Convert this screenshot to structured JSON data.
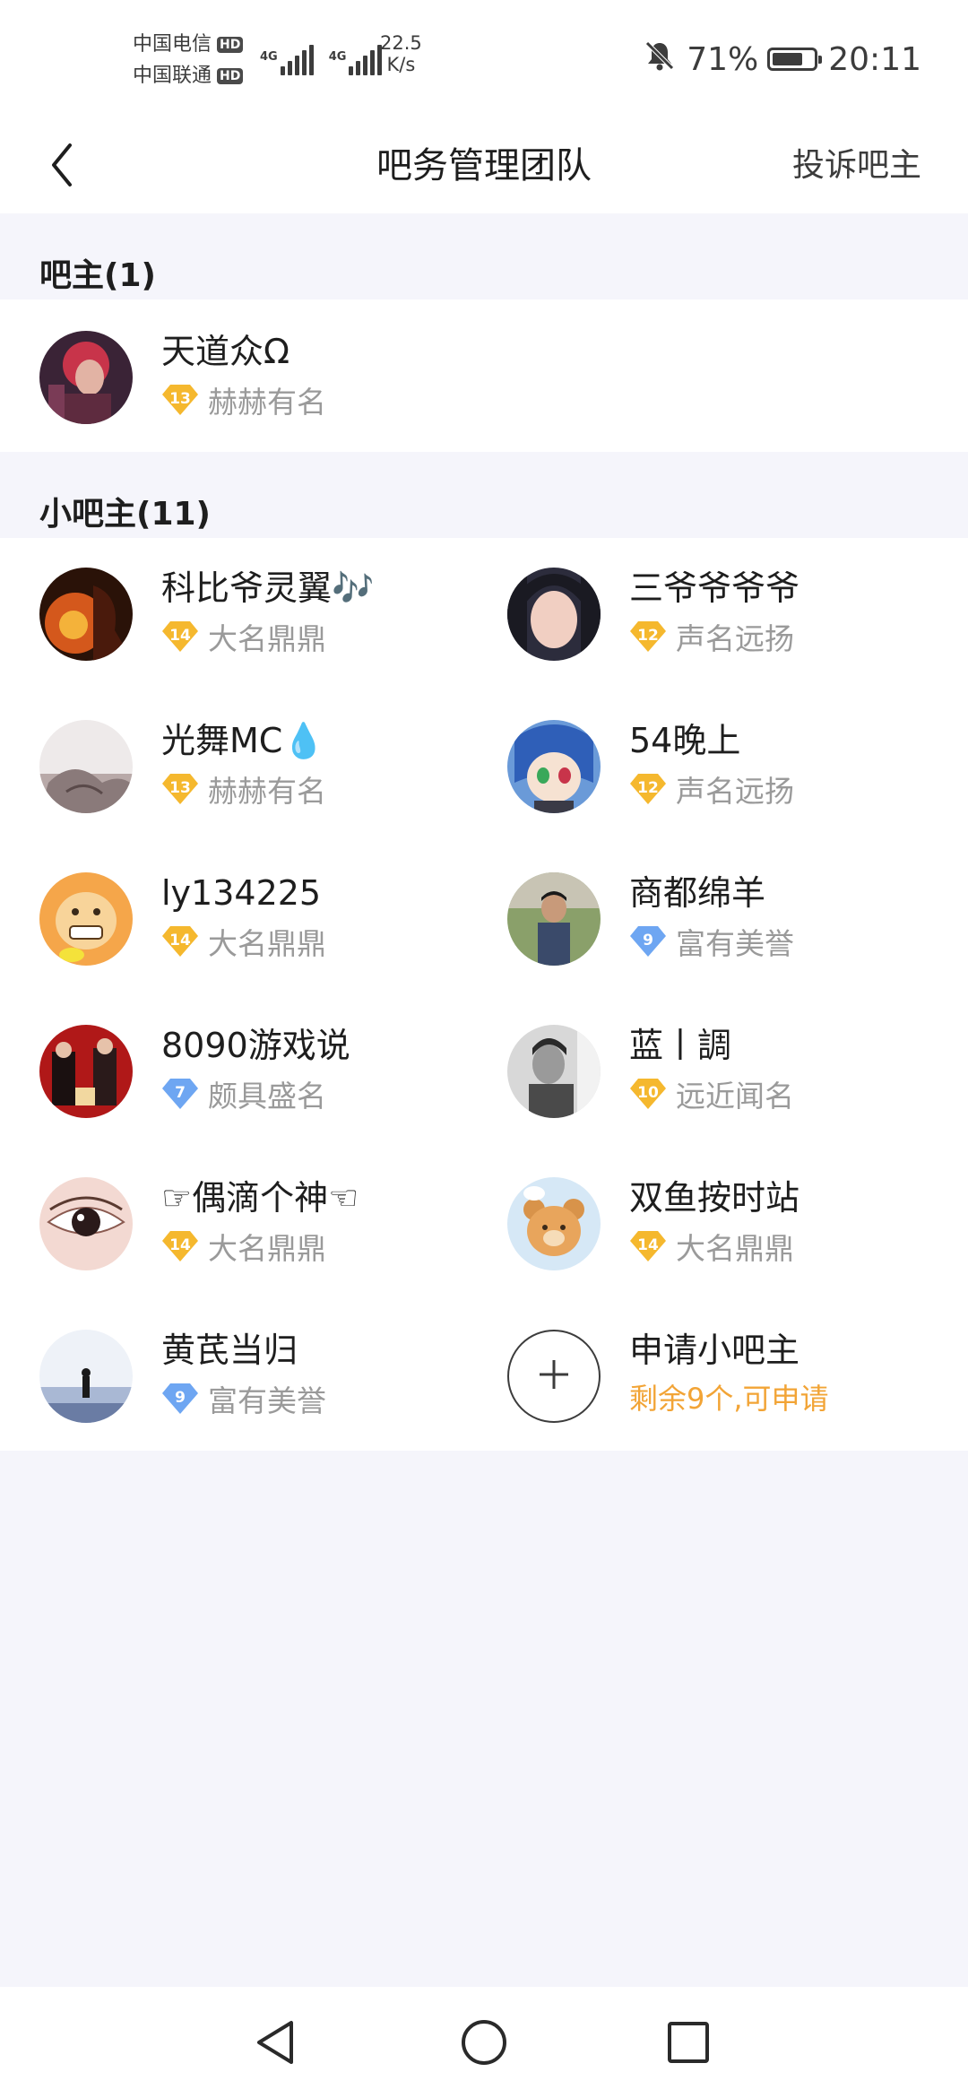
{
  "status_bar": {
    "carriers": [
      "中国电信",
      "中国联通"
    ],
    "hd_label": "HD",
    "network_type": "4G",
    "speed_value": "22.5",
    "speed_unit": "K/s",
    "battery": "71%",
    "time": "20:11"
  },
  "header": {
    "title": "吧务管理团队",
    "complaint": "投诉吧主"
  },
  "owner_section": {
    "title": "吧主(1)",
    "members": [
      {
        "name": "天道众Ω",
        "level": "13",
        "level_title": "赫赫有名",
        "badge_color": "#f5b82e"
      }
    ]
  },
  "moderator_section": {
    "title": "小吧主(11)",
    "members": [
      {
        "name": "科比爷灵翼🎶",
        "level": "14",
        "level_title": "大名鼎鼎",
        "badge_color": "#f5b82e"
      },
      {
        "name": "三爷爷爷爷",
        "level": "12",
        "level_title": "声名远扬",
        "badge_color": "#f5b82e"
      },
      {
        "name": "光舞MC💧",
        "level": "13",
        "level_title": "赫赫有名",
        "badge_color": "#f5b82e"
      },
      {
        "name": "54晚上",
        "level": "12",
        "level_title": "声名远扬",
        "badge_color": "#f5b82e"
      },
      {
        "name": "ly134225",
        "level": "14",
        "level_title": "大名鼎鼎",
        "badge_color": "#f5b82e"
      },
      {
        "name": "商都绵羊",
        "level": "9",
        "level_title": "富有美誉",
        "badge_color": "#6ea6f2"
      },
      {
        "name": "8090游戏说",
        "level": "7",
        "level_title": "颇具盛名",
        "badge_color": "#6ea6f2"
      },
      {
        "name": "蓝丨調",
        "level": "10",
        "level_title": "远近闻名",
        "badge_color": "#f5b82e"
      },
      {
        "name": "☞偶滴个神☜",
        "level": "14",
        "level_title": "大名鼎鼎",
        "badge_color": "#f5b82e"
      },
      {
        "name": "双鱼按时站",
        "level": "14",
        "level_title": "大名鼎鼎",
        "badge_color": "#f5b82e"
      },
      {
        "name": "黄芪当归",
        "level": "9",
        "level_title": "富有美誉",
        "badge_color": "#6ea6f2"
      }
    ],
    "apply": {
      "label": "申请小吧主",
      "sub": "剩余9个,可申请"
    }
  },
  "colors": {
    "accent_orange": "#f2a436",
    "badge_gold": "#f5b82e",
    "badge_blue": "#6ea6f2",
    "page_background": "#f5f5fb"
  },
  "icons": {
    "back": "chevron-left-icon",
    "bell": "bell-off-icon",
    "battery": "battery-icon",
    "apply": "plus-icon",
    "nav": [
      "back-triangle-icon",
      "home-circle-icon",
      "recents-square-icon"
    ]
  }
}
